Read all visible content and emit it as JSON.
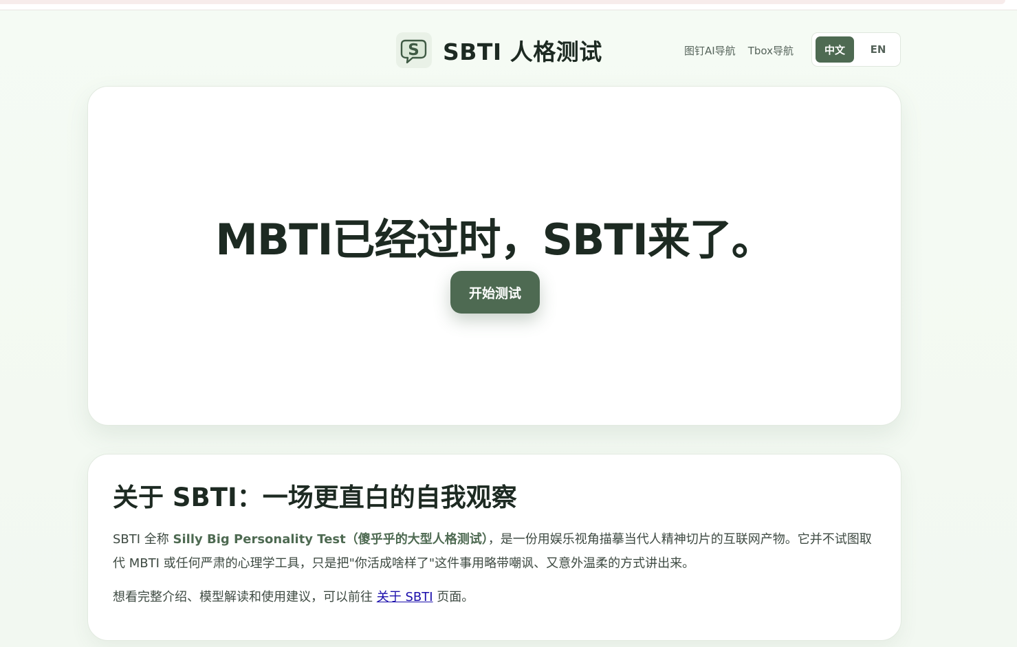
{
  "header": {
    "brand_title": "SBTI 人格测试",
    "logo_icon": "speech-bubble-s-icon",
    "nav_links": [
      "图钉AI导航",
      "Tbox导航"
    ],
    "languages": [
      {
        "label": "中文",
        "active": true
      },
      {
        "label": "EN",
        "active": false
      }
    ]
  },
  "hero": {
    "title": "MBTI已经过时，SBTI来了。",
    "start_button": "开始测试"
  },
  "about": {
    "title": "关于 SBTI：一场更直白的自我观察",
    "p1_prefix": "SBTI 全称 ",
    "p1_strong": "Silly Big Personality Test（傻乎乎的大型人格测试）",
    "p1_suffix": "，是一份用娱乐视角描摹当代人精神切片的互联网产物。它并不试图取代 MBTI 或任何严肃的心理学工具，只是把\"你活成啥样了\"这件事用略带嘲讽、又意外温柔的方式讲出来。",
    "p2_prefix": "想看完整介绍、模型解读和使用建议，可以前往 ",
    "p2_link": "关于 SBTI",
    "p2_suffix": " 页面。"
  },
  "colors": {
    "accent": "#4e6a52",
    "text": "#1d2a22",
    "background": "#f4faf3",
    "link": "#1a0dab"
  }
}
